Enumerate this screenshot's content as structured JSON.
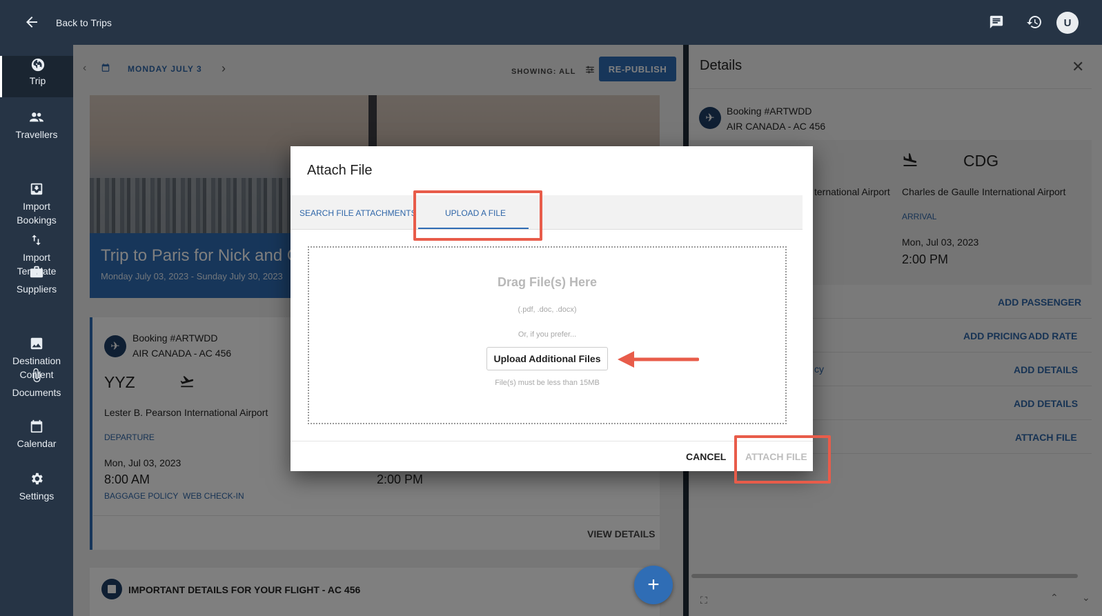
{
  "topbar": {
    "back_label": "Back to Trips",
    "icons": [
      "arrow-left-icon",
      "chat-icon",
      "history-icon",
      "user-avatar"
    ],
    "avatar_letter": "U"
  },
  "sidebar": {
    "items": [
      {
        "label": "Trip",
        "icon": "globe-icon",
        "active": true
      },
      {
        "label": "Travellers",
        "icon": "people-icon"
      },
      {
        "label": "Import\nBookings",
        "icon": "import-icon"
      },
      {
        "label": "Import\nTemplate",
        "icon": "swap-icon"
      },
      {
        "label": "Suppliers",
        "icon": "briefcase-icon"
      },
      {
        "label": "Destination\nContent",
        "icon": "image-icon"
      },
      {
        "label": "Documents",
        "icon": "paperclip-icon"
      },
      {
        "label": "Calendar",
        "icon": "calendar-icon"
      },
      {
        "label": "Settings",
        "icon": "gear-icon"
      }
    ]
  },
  "main": {
    "date_label": "MONDAY JULY 3",
    "showing_label": "SHOWING: ALL",
    "republish_label": "RE-PUBLISH",
    "hero": {
      "title": "Trip to Paris for Nick and C",
      "dates": "Monday July 03, 2023 - Sunday July 30, 2023"
    },
    "booking": {
      "number": "Booking #ARTWDD",
      "airline": "AIR CANADA - AC 456",
      "origin_code": "YYZ",
      "origin_airport": "Lester B. Pearson International Airport",
      "departure_label": "DEPARTURE",
      "departure_date": "Mon, Jul 03, 2023",
      "departure_time": "8:00 AM",
      "arrival_time": "2:00 PM",
      "baggage_link": "BAGGAGE POLICY",
      "checkin_link": "WEB CHECK-IN",
      "view_details": "VIEW DETAILS"
    },
    "important": "IMPORTANT DETAILS FOR YOUR FLIGHT - AC 456"
  },
  "details": {
    "title": "Details",
    "booking_number": "Booking #ARTWDD",
    "airline": "AIR CANADA - AC 456",
    "dest_code": "CDG",
    "origin_airport_partial": "ternational Airport",
    "dest_airport": "Charles de Gaulle International Airport",
    "arrival_label": "ARRIVAL",
    "arrival_date": "Mon, Jul 03, 2023",
    "arrival_time": "2:00 PM",
    "partial_text": "cy",
    "actions": {
      "add_passenger": "ADD PASSENGER",
      "add_pricing": "ADD PRICING",
      "add_rate": "ADD RATE",
      "add_details_1": "ADD DETAILS",
      "add_details_2": "ADD DETAILS",
      "attach_file": "ATTACH FILE"
    }
  },
  "modal": {
    "title": "Attach File",
    "tabs": [
      {
        "label": "SEARCH FILE ATTACHMENTS",
        "active": false
      },
      {
        "label": "UPLOAD A FILE",
        "active": true
      }
    ],
    "dropzone": {
      "title": "Drag File(s) Here",
      "types": "(.pdf, .doc, .docx)",
      "or_text": "Or, if you prefer...",
      "upload_button": "Upload Additional Files",
      "limit": "File(s) must be less than 15MB"
    },
    "cancel_label": "CANCEL",
    "attach_label": "ATTACH FILE"
  },
  "colors": {
    "navy": "#263445",
    "accent": "#2f6db5",
    "highlight": "#e85c4a"
  }
}
